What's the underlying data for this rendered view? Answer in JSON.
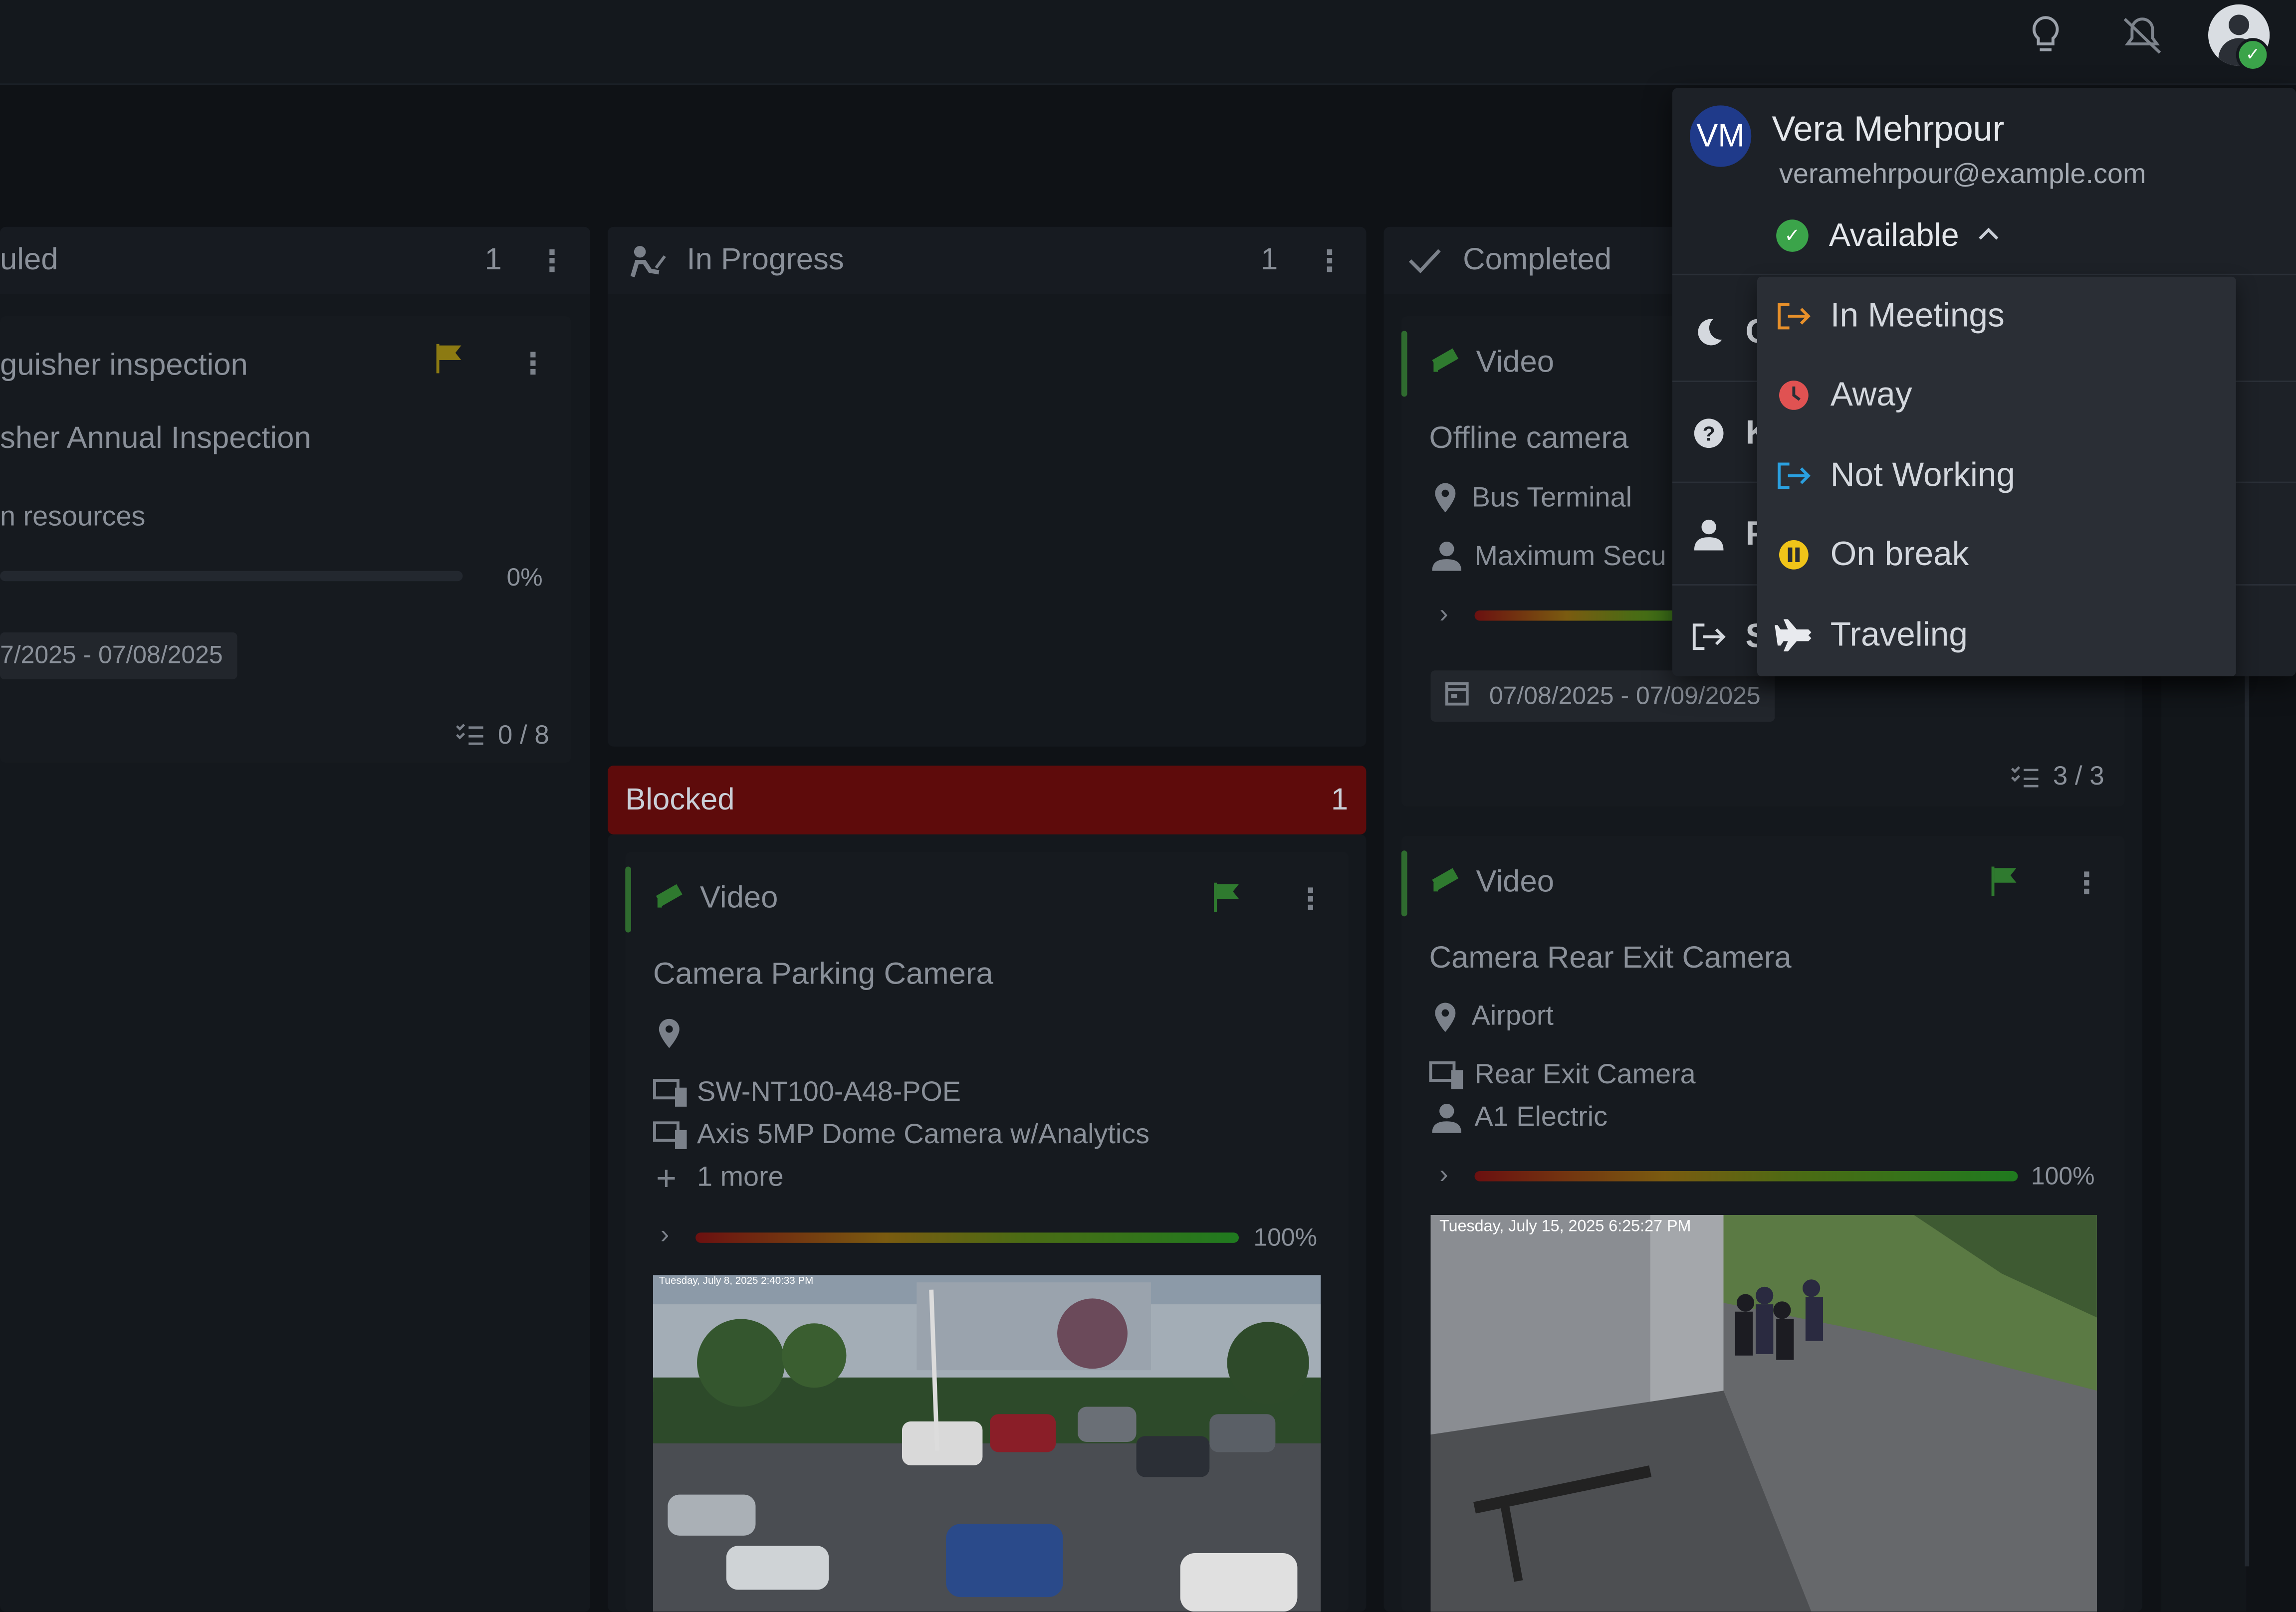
{
  "colors": {
    "background": "#0f1216",
    "blocked_header": "#5e0b0b",
    "available": "#3ba44a",
    "in_meetings": "#e8902a",
    "away": "#e05252",
    "not_working": "#2aa0e0",
    "on_break": "#f0c419"
  },
  "topbar": {
    "icons": [
      "lightbulb-icon",
      "bell-off-icon",
      "user-avatar-icon"
    ]
  },
  "columns": {
    "scheduled": {
      "title": "uled",
      "count": "1",
      "card": {
        "title": "guisher inspection",
        "subtitle": "sher Annual Inspection",
        "resources": "n resources",
        "progress": "0%",
        "progress_value": 0,
        "date_range": "7/2025 - 07/08/2025",
        "checklist": "0 / 8"
      }
    },
    "in_progress": {
      "title": "In Progress",
      "count": "1"
    },
    "blocked": {
      "title": "Blocked",
      "count": "1",
      "card": {
        "category": "Video",
        "title": "Camera Parking Camera",
        "device1": "SW-NT100-A48-POE",
        "device2": "Axis 5MP Dome Camera w/Analytics",
        "more": "1 more",
        "progress": "100%",
        "progress_value": 100,
        "image_timestamp": "Tuesday, July 8, 2025 2:40:33 PM"
      }
    },
    "completed": {
      "title": "Completed",
      "card1": {
        "category": "Video",
        "title": "Offline camera",
        "location": "Bus Terminal",
        "assignee": "Maximum Secu",
        "date_range": "07/08/2025 - 07/09/2025",
        "checklist": "3 / 3"
      },
      "card2": {
        "category": "Video",
        "title": "Camera Rear Exit Camera",
        "location": "Airport",
        "device": "Rear Exit Camera",
        "assignee": "A1 Electric",
        "progress": "100%",
        "progress_value": 100,
        "image_timestamp": "Tuesday, July 15, 2025 6:25:27 PM"
      }
    }
  },
  "user_menu": {
    "initials": "VM",
    "name": "Vera Mehrpour",
    "email": "veramehrpour@example.com",
    "status": "Available",
    "items": [
      {
        "letter": "C",
        "icon": "moon-icon"
      },
      {
        "letter": "K",
        "icon": "help-icon"
      },
      {
        "letter": "P",
        "icon": "person-icon"
      },
      {
        "letter": "S",
        "icon": "sign-out-icon"
      }
    ],
    "status_options": [
      {
        "label": "In Meetings",
        "icon": "in-meetings-icon"
      },
      {
        "label": "Away",
        "icon": "clock-icon"
      },
      {
        "label": "Not Working",
        "icon": "not-working-icon"
      },
      {
        "label": "On break",
        "icon": "pause-icon"
      },
      {
        "label": "Traveling",
        "icon": "airplane-icon"
      }
    ]
  }
}
